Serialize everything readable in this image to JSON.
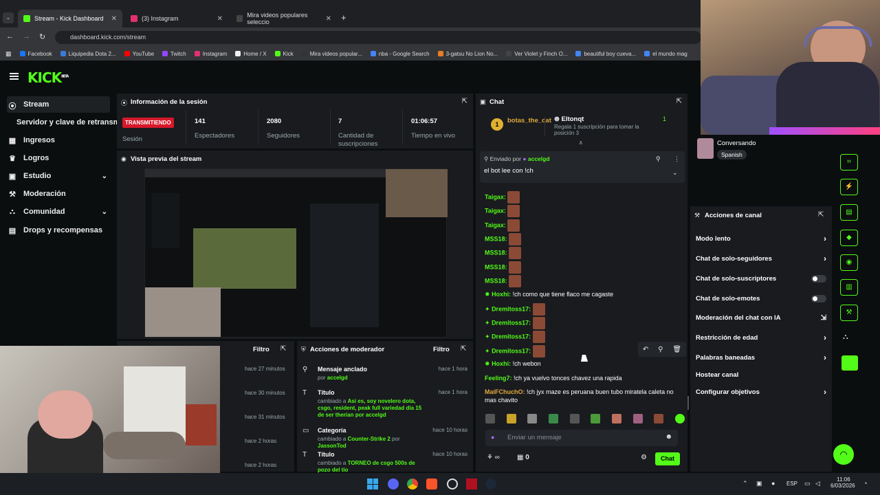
{
  "browser": {
    "tabs": [
      {
        "label": "Stream - Kick Dashboard",
        "color": "#53fc18",
        "active": true
      },
      {
        "label": "(3) Instagram",
        "color": "#e1306c"
      },
      {
        "label": "Mira videos populares seleccio",
        "color": "#222"
      }
    ],
    "url": "dashboard.kick.com/stream",
    "bookmarks": [
      {
        "label": "Facebook",
        "color": "#1877f2"
      },
      {
        "label": "Liquipedia Dota 2...",
        "color": "#3a7bd5"
      },
      {
        "label": "YouTube",
        "color": "#ff0000"
      },
      {
        "label": "Twitch",
        "color": "#9146ff"
      },
      {
        "label": "Instagram",
        "color": "#e1306c"
      },
      {
        "label": "Home / X",
        "color": "#eeeeee"
      },
      {
        "label": "Kick",
        "color": "#53fc18"
      },
      {
        "label": "Mira videos popular...",
        "color": "#333"
      },
      {
        "label": "nba - Google Search",
        "color": "#4285f4"
      },
      {
        "label": "3-gatsu No Lion No...",
        "color": "#e67e22"
      },
      {
        "label": "Ver Violet y Finch O...",
        "color": "#444"
      },
      {
        "label": "beautiful boy cueva...",
        "color": "#4285f4"
      },
      {
        "label": "el mundo mag",
        "color": "#4285f4"
      }
    ]
  },
  "app": {
    "logo": "KICK",
    "logo_sup": "BETA"
  },
  "sidebar": {
    "items": [
      {
        "label": "Stream",
        "icon": "broadcast-icon"
      },
      {
        "label": "Servidor y clave de retransm"
      },
      {
        "label": "Ingresos",
        "icon": "chart-icon"
      },
      {
        "label": "Logros",
        "icon": "trophy-icon"
      },
      {
        "label": "Estudio",
        "icon": "studio-icon",
        "chevron": true
      },
      {
        "label": "Moderación",
        "icon": "wrench-icon"
      },
      {
        "label": "Comunidad",
        "icon": "people-icon",
        "chevron": true
      },
      {
        "label": "Drops y recompensas",
        "icon": "gift-icon"
      }
    ]
  },
  "session": {
    "title": "Información de la sesión",
    "live_badge": "TRANSMITIENDO",
    "session_label": "Sesión",
    "stats": [
      {
        "value": "141",
        "label": "Espectadores"
      },
      {
        "value": "2080",
        "label": "Seguidores"
      },
      {
        "value": "7",
        "label": "Cantidad de suscripciones"
      },
      {
        "value": "01:06:57",
        "label": "Tiempo en vivo"
      }
    ]
  },
  "preview": {
    "title": "Vista previa del stream"
  },
  "activity": {
    "filter": "Filtro",
    "times": [
      "hace 27 minutos",
      "hace 30 minutos",
      "hace 31 minutos",
      "hace 2 horas",
      "hace 2 horas"
    ]
  },
  "modactions": {
    "title": "Acciones de moderador",
    "filter": "Filtro",
    "items": [
      {
        "title": "Mensaje anclado",
        "sub": "por ",
        "user": "accelgd",
        "time": "hace 1 hora"
      },
      {
        "title": "Título",
        "sub": "cambiado a ",
        "detail": "Asi es, soy novelero dota, csgo, resident, peak full variedad día 15 de ser therian por",
        "user": "accelgd",
        "time": "hace 1 hora"
      },
      {
        "title": "Categoría",
        "sub": "cambiado a ",
        "detail": "Counter-Strike 2",
        "by": " por ",
        "user": "JassonTod",
        "time": "hace 10 horas"
      },
      {
        "title": "Título",
        "sub": "cambiado a ",
        "detail": "TORNEO de csgo 500s de pozo del tio",
        "time": "hace 10 horas"
      }
    ]
  },
  "chat": {
    "title": "Chat",
    "top_gifter": {
      "name": "botas_the_cat",
      "rank": "1"
    },
    "gift_promo": {
      "name": "Eltonqt",
      "text": "Regala 1 suscripción para tomar la posición 3",
      "count": "1"
    },
    "pinned": {
      "label": "Enviado por",
      "user": "accelgd",
      "message": "el bot lee con !ch"
    },
    "messages": [
      {
        "user": "Taigax:",
        "color": "#53fc18",
        "emote": true
      },
      {
        "user": "Taigax:",
        "color": "#53fc18",
        "emote": true
      },
      {
        "user": "Taigax:",
        "color": "#53fc18",
        "emote": true
      },
      {
        "user": "MSS18:",
        "color": "#53fc18",
        "emote": true
      },
      {
        "user": "MSS18:",
        "color": "#53fc18",
        "emote": true
      },
      {
        "user": "MSS18:",
        "color": "#53fc18",
        "emote": true
      },
      {
        "user": "MSS18:",
        "color": "#53fc18",
        "emote": true
      },
      {
        "user": "Hoxhi:",
        "color": "#53fc18",
        "text": "!ch como que tiene flaco me cagaste"
      },
      {
        "user": "Dremitoss17:",
        "color": "#53fc18",
        "emote": true
      },
      {
        "user": "Dremitoss17:",
        "color": "#53fc18",
        "emote": true
      },
      {
        "user": "Dremitoss17:",
        "color": "#53fc18",
        "emote": true
      },
      {
        "user": "Dremitoss17:",
        "color": "#53fc18",
        "emote": true
      },
      {
        "user": "Hoxhi:",
        "color": "#53fc18",
        "text": "!ch webon"
      },
      {
        "user": "Feeling7:",
        "color": "#53fc18",
        "text": "!ch ya vuelvo tonces chavez una rapida"
      },
      {
        "user": "MaiFChuchO:",
        "color": "#e0a93a",
        "text": "!ch jyx maze es peruana buen tubo miratela caleta no mas chavito"
      }
    ],
    "input_placeholder": "Enviar un mensaje",
    "infinity": "∞",
    "count": "0",
    "send": "Chat"
  },
  "right": {
    "status": "Conversando",
    "language": "Spanish",
    "channel_actions_title": "Acciones de canal",
    "actions": [
      {
        "label": "Modo lento",
        "type": "chevron"
      },
      {
        "label": "Chat de solo-seguidores",
        "type": "chevron"
      },
      {
        "label": "Chat de solo-suscriptores",
        "type": "toggle"
      },
      {
        "label": "Chat de solo-emotes",
        "type": "toggle"
      },
      {
        "label": "Moderación del chat con IA",
        "type": "link"
      },
      {
        "label": "Restricción de edad",
        "type": "chevron"
      },
      {
        "label": "Palabras baneadas",
        "type": "chevron"
      },
      {
        "label": "Hostear canal",
        "type": "none"
      },
      {
        "label": "Configurar objetivos",
        "type": "chevron"
      }
    ]
  },
  "taskbar": {
    "lang": "ESP",
    "time": "11:06",
    "date": "6/03/2026"
  }
}
